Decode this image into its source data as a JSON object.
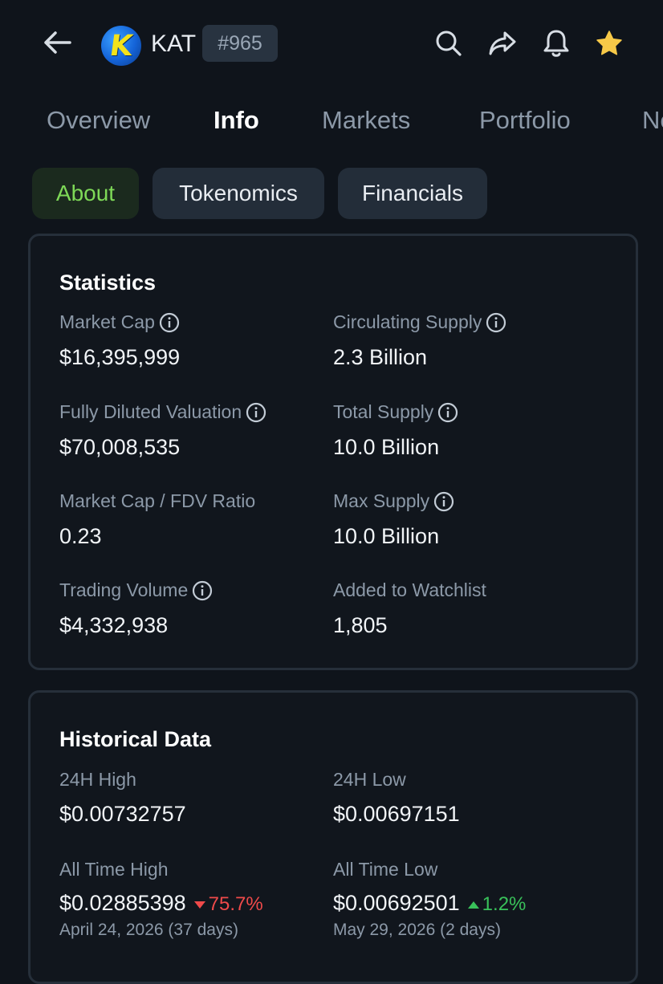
{
  "header": {
    "symbol": "KAT",
    "rank": "#965",
    "logo_letter": "K",
    "icons": [
      "back-arrow-icon",
      "search-icon",
      "share-icon",
      "bell-icon",
      "star-icon"
    ],
    "star_color": "#f7c948"
  },
  "tabs": [
    "Overview",
    "Info",
    "Markets",
    "Portfolio",
    "News"
  ],
  "active_tab": "Info",
  "subtabs": [
    "About",
    "Tokenomics",
    "Financials"
  ],
  "active_subtab": "About",
  "colors": {
    "accent_green": "#7ed957",
    "negative": "#ef4a4a",
    "positive": "#39c15a"
  },
  "statistics": {
    "title": "Statistics",
    "market_cap": {
      "label": "Market Cap",
      "value": "$16,395,999"
    },
    "circulating_supply": {
      "label": "Circulating Supply",
      "value": "2.3 Billion"
    },
    "fdv": {
      "label": "Fully Diluted Valuation",
      "value": "$70,008,535"
    },
    "total_supply": {
      "label": "Total Supply",
      "value": "10.0 Billion"
    },
    "mc_fdv_ratio": {
      "label": "Market Cap / FDV Ratio",
      "value": "0.23"
    },
    "max_supply": {
      "label": "Max Supply",
      "value": "10.0 Billion"
    },
    "trading_volume": {
      "label": "Trading Volume",
      "value": "$4,332,938"
    },
    "watchlist": {
      "label": "Added to Watchlist",
      "value": "1,805"
    }
  },
  "historical": {
    "title": "Historical Data",
    "high_24h": {
      "label": "24H High",
      "value": "$0.00732757"
    },
    "low_24h": {
      "label": "24H Low",
      "value": "$0.00697151"
    },
    "ath": {
      "label": "All Time High",
      "value": "$0.02885398",
      "change": "75.7%",
      "date": "April 24, 2026 (37 days)"
    },
    "atl": {
      "label": "All Time Low",
      "value": "$0.00692501",
      "change": "1.2%",
      "date": "May 29, 2026 (2 days)"
    }
  }
}
